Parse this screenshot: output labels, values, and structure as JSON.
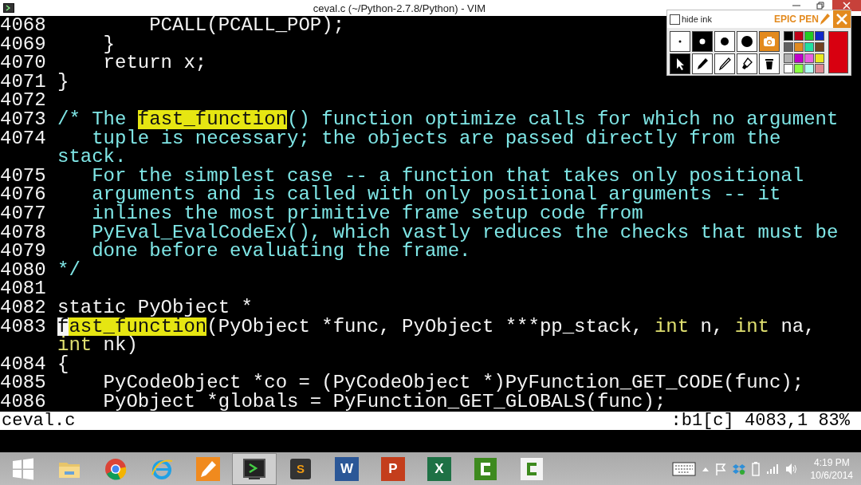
{
  "window": {
    "title": "ceval.c (~/Python-2.7.8/Python) - VIM"
  },
  "editor": {
    "lines": [
      {
        "number": "4068",
        "segments": [
          {
            "kind": "code",
            "text": "        PCALL(PCALL_POP);"
          }
        ]
      },
      {
        "number": "4069",
        "segments": [
          {
            "kind": "code",
            "text": "    }"
          }
        ]
      },
      {
        "number": "4070",
        "segments": [
          {
            "kind": "code",
            "text": "    return x;"
          }
        ]
      },
      {
        "number": "4071",
        "segments": [
          {
            "kind": "code",
            "text": "}"
          }
        ]
      },
      {
        "number": "4072"
      },
      {
        "number": "4073",
        "segments": [
          {
            "kind": "comment",
            "text": "/* The "
          },
          {
            "kind": "match",
            "text": "fast_function"
          },
          {
            "kind": "comment",
            "text": "() function optimize calls for which no argument"
          }
        ]
      },
      {
        "number": "4074",
        "segments": [
          {
            "kind": "comment",
            "text": "   tuple is necessary; the objects are passed directly from the"
          }
        ]
      },
      {
        "segments": [
          {
            "kind": "comment",
            "text": "stack."
          }
        ]
      },
      {
        "number": "4075",
        "segments": [
          {
            "kind": "comment",
            "text": "   For the simplest case -- a function that takes only positional"
          }
        ]
      },
      {
        "number": "4076",
        "segments": [
          {
            "kind": "comment",
            "text": "   arguments and is called with only positional arguments -- it"
          }
        ]
      },
      {
        "number": "4077",
        "segments": [
          {
            "kind": "comment",
            "text": "   inlines the most primitive frame setup code from"
          }
        ]
      },
      {
        "number": "4078",
        "segments": [
          {
            "kind": "comment",
            "text": "   PyEval_EvalCodeEx(), which vastly reduces the checks that must be"
          }
        ]
      },
      {
        "number": "4079",
        "segments": [
          {
            "kind": "comment",
            "text": "   done before evaluating the frame."
          }
        ]
      },
      {
        "number": "4080",
        "segments": [
          {
            "kind": "comment",
            "text": "*/"
          }
        ]
      },
      {
        "number": "4081"
      },
      {
        "number": "4082",
        "segments": [
          {
            "kind": "code",
            "text": "static PyObject *"
          }
        ]
      },
      {
        "number": "4083",
        "segments": [
          {
            "kind": "cursor",
            "text": "f"
          },
          {
            "kind": "match",
            "text": "ast_function"
          },
          {
            "kind": "code",
            "text": "(PyObject *func, PyObject ***pp_stack, "
          },
          {
            "kind": "type",
            "text": "int"
          },
          {
            "kind": "code",
            "text": " n, "
          },
          {
            "kind": "type",
            "text": "int"
          },
          {
            "kind": "code",
            "text": " na,"
          }
        ]
      },
      {
        "segments": [
          {
            "kind": "type",
            "text": "int"
          },
          {
            "kind": "code",
            "text": " nk)"
          }
        ]
      },
      {
        "number": "4084",
        "segments": [
          {
            "kind": "code",
            "text": "{"
          }
        ]
      },
      {
        "number": "4085",
        "segments": [
          {
            "kind": "code",
            "text": "    PyCodeObject *co = (PyCodeObject *)PyFunction_GET_CODE(func);"
          }
        ]
      },
      {
        "number": "4086",
        "segments": [
          {
            "kind": "code",
            "text": "    PyObject *globals = PyFunction_GET_GLOBALS(func);"
          }
        ]
      }
    ]
  },
  "status_line": {
    "file": "ceval.c",
    "position": ":b1[c] 4083,1 83%"
  },
  "epic_pen": {
    "hide_ink": {
      "label": "hide ink",
      "checked": false
    },
    "title": "EPIC PEN",
    "tools": [
      {
        "kind": "dot-small",
        "selected": false
      },
      {
        "kind": "dot-medium",
        "selected": true
      },
      {
        "kind": "dot-large",
        "selected": false
      },
      {
        "kind": "dot-xlarge",
        "selected": false
      },
      {
        "kind": "camera",
        "selected": false
      },
      {
        "kind": "pointer",
        "selected": true
      },
      {
        "kind": "pen",
        "selected": false
      },
      {
        "kind": "pencil",
        "selected": false
      },
      {
        "kind": "highlighter",
        "selected": false
      },
      {
        "kind": "trash",
        "selected": false
      }
    ],
    "palette": [
      {
        "color": "#000000"
      },
      {
        "color": "#c00018"
      },
      {
        "color": "#22cc22"
      },
      {
        "color": "#1028c8"
      },
      {
        "color": "#606060"
      },
      {
        "color": "#e08a20"
      },
      {
        "color": "#20e0a0"
      },
      {
        "color": "#704020"
      },
      {
        "color": "#b0b0b0"
      },
      {
        "color": "#c000c8"
      },
      {
        "color": "#e860e0"
      },
      {
        "color": "#e8e820"
      },
      {
        "color": "#ffffff"
      },
      {
        "color": "#88ff40"
      },
      {
        "color": "#b0fff0"
      },
      {
        "color": "#e08890"
      }
    ],
    "current": {
      "color": "#d80010"
    }
  },
  "taskbar": {
    "apps": [
      {
        "kind": "start",
        "selected": false
      },
      {
        "kind": "folder",
        "selected": false
      },
      {
        "kind": "chrome",
        "selected": false
      },
      {
        "kind": "ie",
        "selected": false
      },
      {
        "kind": "pen",
        "selected": false
      },
      {
        "kind": "vim",
        "selected": true
      },
      {
        "kind": "sublime",
        "label": "S",
        "selected": false
      },
      {
        "kind": "word",
        "label": "W",
        "selected": false
      },
      {
        "kind": "powerpoint",
        "label": "P",
        "selected": false
      },
      {
        "kind": "excel",
        "label": "X",
        "selected": false
      },
      {
        "kind": "camtasia",
        "selected": false
      },
      {
        "kind": "camtasia-light",
        "selected": false
      }
    ],
    "time": "4:19 PM",
    "date": "10/6/2014"
  }
}
